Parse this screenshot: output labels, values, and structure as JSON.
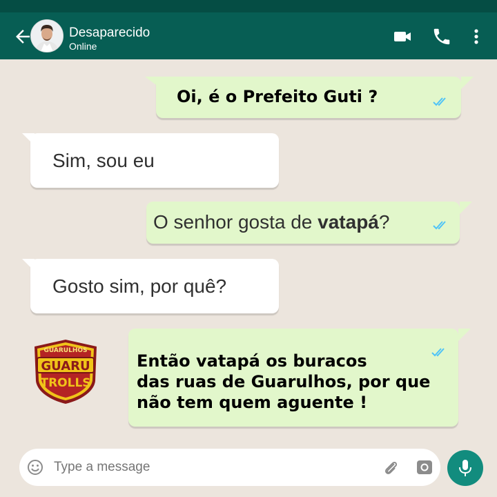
{
  "header": {
    "contact_name": "Desaparecido",
    "status": "Online",
    "icons": [
      "back-arrow-icon",
      "video-call-icon",
      "phone-icon",
      "more-options-icon"
    ]
  },
  "messages": [
    {
      "direction": "outgoing",
      "text": "Oi, é o Prefeito Guti ?",
      "read": true
    },
    {
      "direction": "incoming",
      "text": "Sim, sou eu"
    },
    {
      "direction": "outgoing",
      "text_before": "O senhor gosta de ",
      "text_bold": "vatapá",
      "text_after": "?",
      "read": true
    },
    {
      "direction": "incoming",
      "text": "Gosto sim, por quê?"
    },
    {
      "direction": "outgoing",
      "lines": [
        "Então vatapá os buracos",
        "das ruas de Guarulhos, por que",
        "não tem quem aguente !"
      ],
      "read": true
    }
  ],
  "logo": {
    "top_text": "GUARULHOS",
    "middle_text": "GUARU",
    "bottom_text": "TROLLS"
  },
  "composer": {
    "placeholder": "Type a message"
  },
  "colors": {
    "header": "#075e54",
    "background": "#ece5dd",
    "outgoing_bubble": "#e2f7cb",
    "incoming_bubble": "#ffffff",
    "read_ticks": "#4fc3f7",
    "mic_button": "#128c7e"
  }
}
